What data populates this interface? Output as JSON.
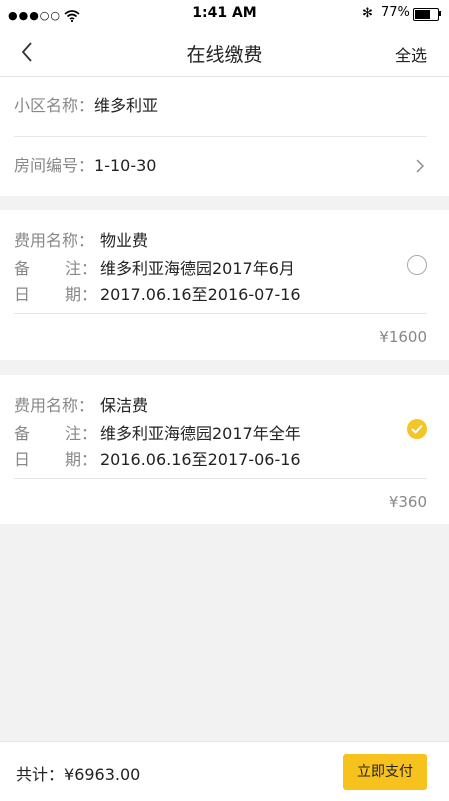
{
  "status_bar": {
    "signal": "●●●○○",
    "time": "1:41 AM",
    "battery": "77%",
    "battery_level": 0.77
  },
  "nav": {
    "title": "在线缴费",
    "action": "全选"
  },
  "community": {
    "name_label": "小区名称：",
    "name_value": "维多利亚",
    "room_label": "房间编号：",
    "room_value": "1-10-30"
  },
  "fees": [
    {
      "name_label": "费用名称：",
      "name_value": "物业费",
      "note_label_a": "备",
      "note_label_b": "注：",
      "note_value": "维多利亚海德园2017年6月",
      "date_label_a": "日",
      "date_label_b": "期：",
      "date_value": "2017.06.16至2016-07-16",
      "price": "¥1600",
      "selected": false
    },
    {
      "name_label": "费用名称：",
      "name_value": "保洁费",
      "note_label_a": "备",
      "note_label_b": "注：",
      "note_value": "维多利亚海德园2017年全年",
      "date_label_a": "日",
      "date_label_b": "期：",
      "date_value": "2016.06.16至2017-06-16",
      "price": "¥360",
      "selected": true
    }
  ],
  "footer": {
    "total_label": "共计：",
    "total_value": "¥6963.00",
    "pay_label": "立即支付"
  },
  "colors": {
    "accent": "#f7c11e",
    "background": "#f2f2f2"
  }
}
